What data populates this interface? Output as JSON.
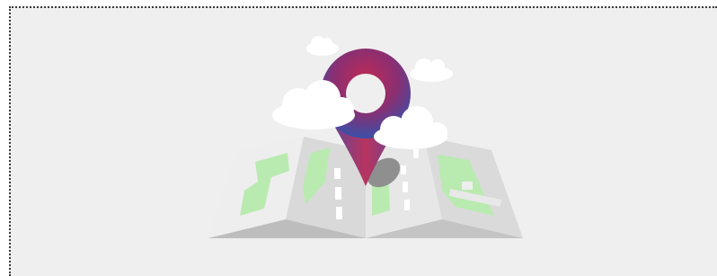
{
  "panel": {
    "background": "#efefef",
    "border_color": "#3a3a3a"
  },
  "illustration": {
    "subject": "map-location-pin",
    "colors": {
      "map_light": "#f2f2f2",
      "map_mid": "#dcdcdc",
      "map_dark": "#c4c4c4",
      "shadow": "#b8b8b8",
      "green": "#b7ebaf",
      "pin_outer": "#3d4fa6",
      "pin_inner": "#b02a5b",
      "cloud": "#ffffff"
    }
  }
}
